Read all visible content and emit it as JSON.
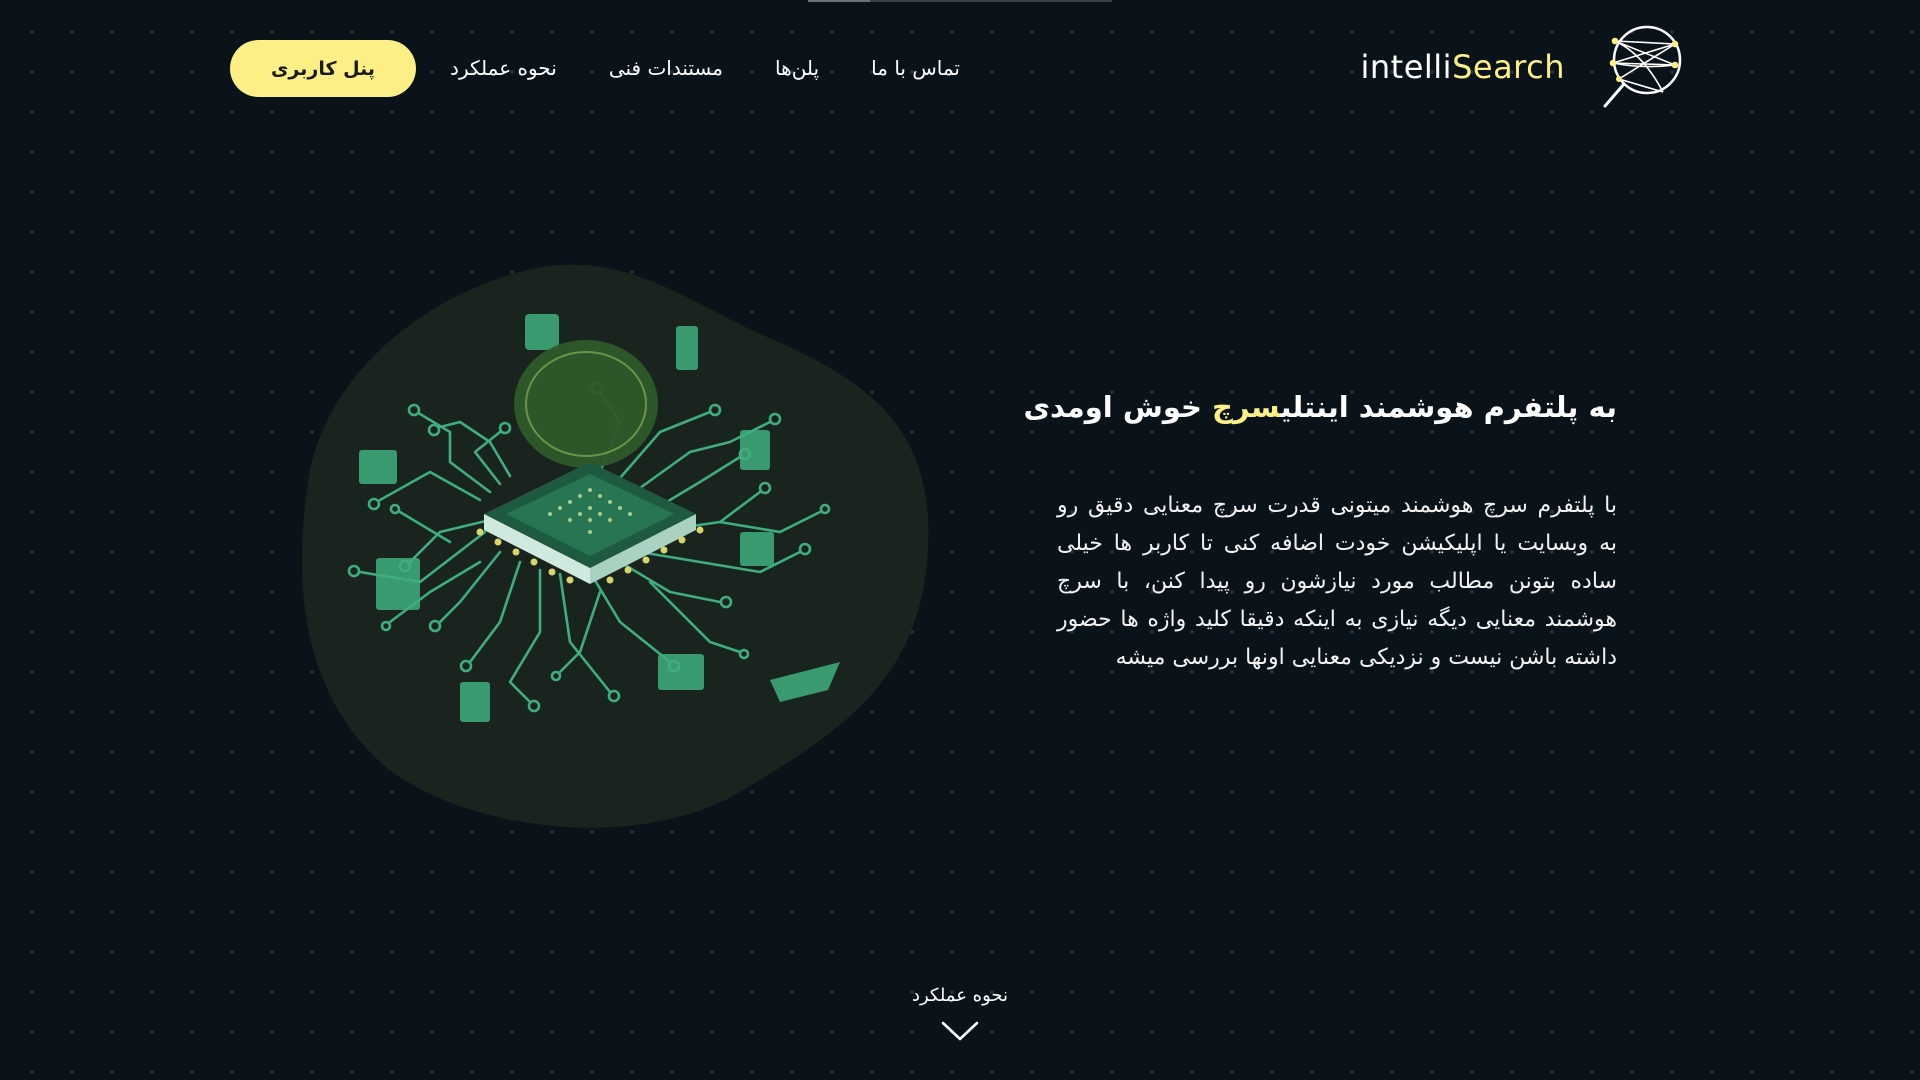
{
  "nav": {
    "panel_button": "پنل کاربری",
    "links": [
      "نحوه عملکرد",
      "مستندات فنی",
      "پلن‌ها",
      "تماس با ما"
    ],
    "brand": {
      "part1": "intelli",
      "part2": "Search"
    }
  },
  "hero": {
    "title_start": "به پلتفرم هوشمند اینتلی",
    "title_accent": "سرچ",
    "title_end": " خوش اومدی",
    "description": "با پلتفرم سرچ هوشمند میتونی قدرت سرچ معنایی دقیق رو به وبسایت یا اپلیکیشن خودت اضافه کنی تا کاربر ها خیلی ساده بتونن مطالب مورد نیازشون رو پیدا کنن، با سرچ هوشمند معنایی دیگه نیازی به اینکه دقیقا کلید واژه ها حضور داشته باشن نیست و نزدیکی معنایی اونها بررسی میشه"
  },
  "scroll_hint": {
    "label": "نحوه عملکرد",
    "icon": "chevron-down-icon"
  },
  "colors": {
    "background": "#0a131a",
    "accent": "#fcef86",
    "circuit": "#3fae7e",
    "blob": "#1a241f"
  }
}
